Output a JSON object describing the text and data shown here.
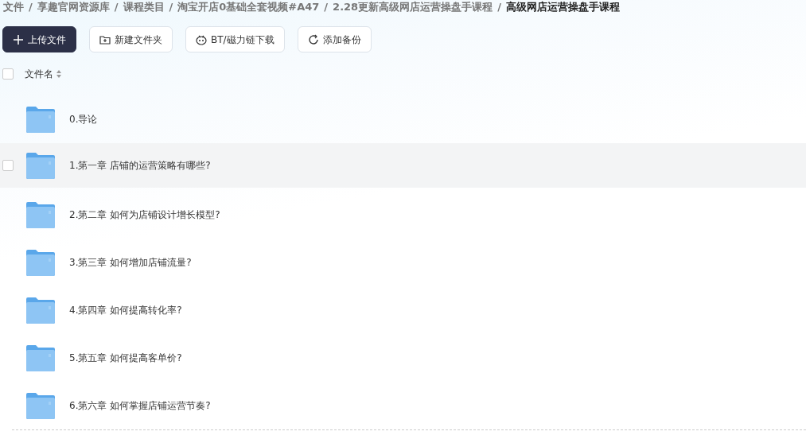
{
  "breadcrumb": [
    {
      "label": "文件",
      "current": false
    },
    {
      "label": "享趣官网资源库",
      "current": false
    },
    {
      "label": "课程类目",
      "current": false
    },
    {
      "label": "淘宝开店0基础全套视频#A47",
      "current": false
    },
    {
      "label": "2.28更新高级网店运营操盘手课程",
      "current": false
    },
    {
      "label": "高级网店运营操盘手课程",
      "current": true
    }
  ],
  "separator": "/",
  "toolbar": [
    {
      "kind": "upload",
      "label": "上传文件",
      "primary": true
    },
    {
      "kind": "folder",
      "label": "新建文件夹",
      "primary": false
    },
    {
      "kind": "bt",
      "label": "BT/磁力链下载",
      "primary": false
    },
    {
      "kind": "backup",
      "label": "添加备份",
      "primary": false
    }
  ],
  "list_header": {
    "label": "文件名",
    "checked": false
  },
  "files": [
    {
      "name": "0.导论",
      "hovered": false,
      "checked": false
    },
    {
      "name": "1.第一章 店铺的运营策略有哪些?",
      "hovered": true,
      "checked": false
    },
    {
      "name": "2.第二章 如何为店铺设计增长模型?",
      "hovered": false,
      "checked": false
    },
    {
      "name": "3.第三章 如何增加店铺流量?",
      "hovered": false,
      "checked": false
    },
    {
      "name": "4.第四章 如何提高转化率?",
      "hovered": false,
      "checked": false
    },
    {
      "name": "5.第五章 如何提高客单价?",
      "hovered": false,
      "checked": false
    },
    {
      "name": "6.第六章 如何掌握店铺运营节奏?",
      "hovered": false,
      "checked": false
    }
  ]
}
